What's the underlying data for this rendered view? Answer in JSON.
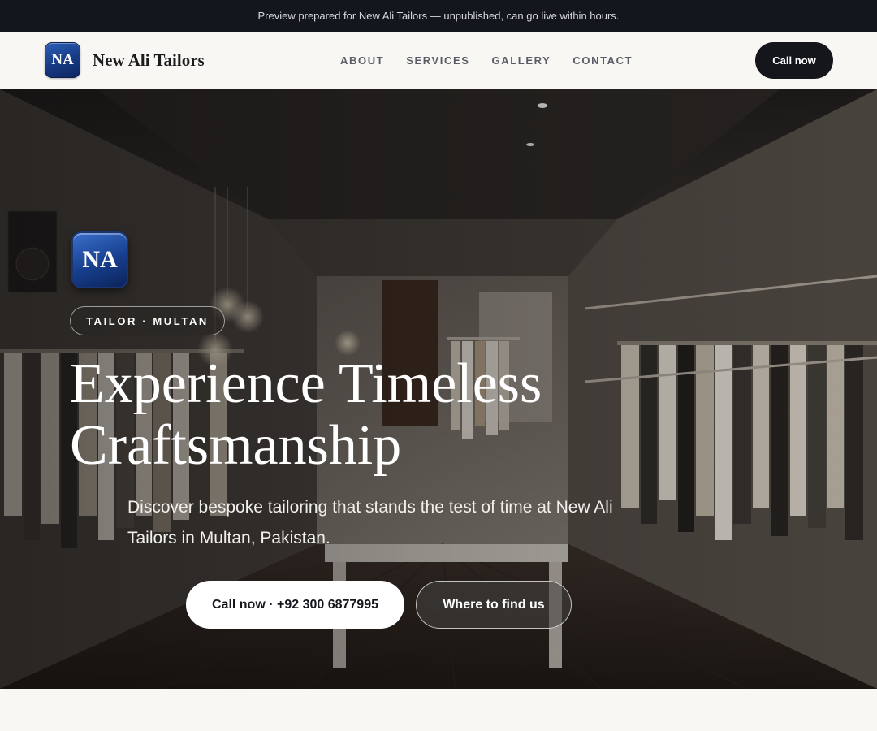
{
  "banner": {
    "text": "Preview prepared for New Ali Tailors — unpublished, can go live within hours."
  },
  "header": {
    "logo_text": "NA",
    "brand_name": "New Ali Tailors",
    "nav": [
      "ABOUT",
      "SERVICES",
      "GALLERY",
      "CONTACT"
    ],
    "cta_label": "Call now"
  },
  "hero": {
    "logo_text": "NA",
    "tag": "TAILOR · MULTAN",
    "title_line1": "Experience Timeless",
    "title_line2": "Craftsmanship",
    "subtitle": "Discover bespoke tailoring that stands the test of time at New Ali Tailors in Multan, Pakistan.",
    "primary_button": "Call now · +92 300 6877995",
    "secondary_button": "Where to find us"
  },
  "colors": {
    "topbar_bg": "#13161d",
    "dark_button": "#14161c",
    "logo_blue": "#173f8d",
    "page_bg": "#f8f7f4"
  },
  "icons": {
    "logo": "monogram-badge"
  }
}
